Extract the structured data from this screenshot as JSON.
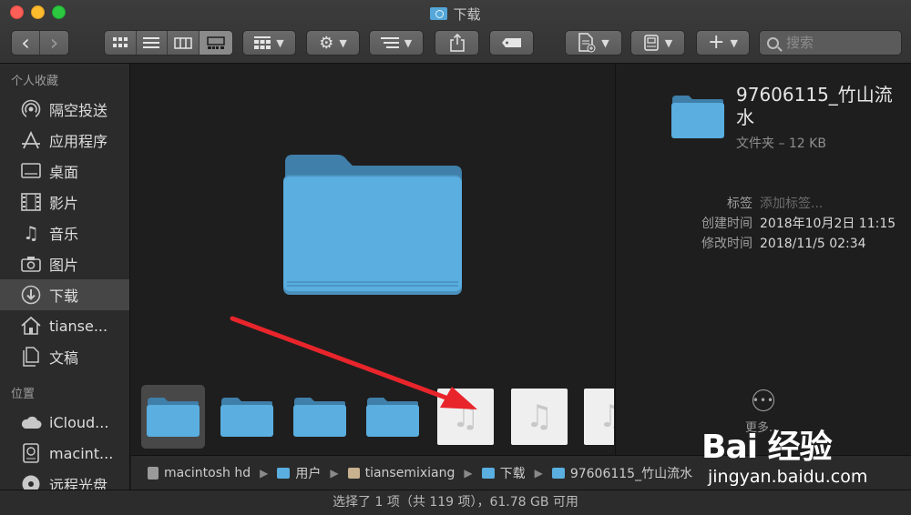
{
  "window": {
    "title": "下载"
  },
  "toolbar": {
    "back_label": "‹",
    "forward_label": "›",
    "share_label": "⇧",
    "tag_label": ""
  },
  "search": {
    "placeholder": "搜索"
  },
  "sidebar": {
    "favorites_title": "个人收藏",
    "favorites": [
      {
        "label": "隔空投送",
        "icon": "airdrop-icon"
      },
      {
        "label": "应用程序",
        "icon": "applications-icon"
      },
      {
        "label": "桌面",
        "icon": "desktop-icon"
      },
      {
        "label": "影片",
        "icon": "movies-icon"
      },
      {
        "label": "音乐",
        "icon": "music-icon"
      },
      {
        "label": "图片",
        "icon": "pictures-icon"
      },
      {
        "label": "下载",
        "icon": "downloads-icon",
        "selected": true
      },
      {
        "label": "tianse...",
        "icon": "home-icon"
      },
      {
        "label": "文稿",
        "icon": "documents-icon"
      }
    ],
    "locations_title": "位置",
    "locations": [
      {
        "label": "iCloud...",
        "icon": "icloud-icon"
      },
      {
        "label": "macint...",
        "icon": "harddisk-icon"
      },
      {
        "label": "远程光盘",
        "icon": "remote-disc-icon"
      }
    ]
  },
  "inspector": {
    "name": "97606115_竹山流水",
    "kind_size": "文件夹 – 12 KB",
    "tags_key": "标签",
    "tags_placeholder": "添加标签...",
    "created_key": "创建时间",
    "created_value": "2018年10月2日 11:15",
    "modified_key": "修改时间",
    "modified_value": "2018/11/5 02:34",
    "more_label": "更多..."
  },
  "pathbar": {
    "items": [
      "macintosh hd",
      "用户",
      "tiansemixiang",
      "下载",
      "97606115_竹山流水"
    ]
  },
  "status": {
    "text": "选择了 1 项（共 119 项），61.78 GB 可用"
  },
  "watermark": {
    "logo": "Bai 经验",
    "site": "jingyan.baidu.com"
  },
  "colors": {
    "folder": "#5aaee0",
    "arrow": "#e8252b",
    "sidebar_selected": "#464646"
  }
}
